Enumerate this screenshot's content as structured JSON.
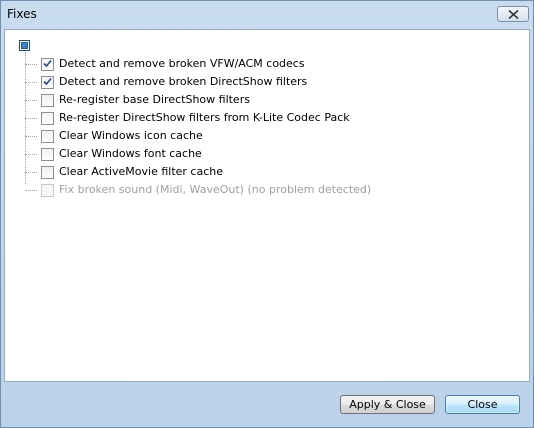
{
  "window": {
    "title": "Fixes"
  },
  "tree": {
    "items": [
      {
        "label": "Detect and remove broken VFW/ACM codecs",
        "checked": true,
        "enabled": true
      },
      {
        "label": "Detect and remove broken DirectShow filters",
        "checked": true,
        "enabled": true
      },
      {
        "label": "Re-register base DirectShow filters",
        "checked": false,
        "enabled": true
      },
      {
        "label": "Re-register DirectShow filters from K-Lite Codec Pack",
        "checked": false,
        "enabled": true
      },
      {
        "label": "Clear Windows icon cache",
        "checked": false,
        "enabled": true
      },
      {
        "label": "Clear Windows font cache",
        "checked": false,
        "enabled": true
      },
      {
        "label": "Clear ActiveMovie filter cache",
        "checked": false,
        "enabled": true
      },
      {
        "label": "Fix broken sound (Midi, WaveOut)  (no problem detected)",
        "checked": false,
        "enabled": false
      }
    ]
  },
  "buttons": {
    "apply_label": "Apply & Close",
    "close_label": "Close"
  },
  "icons": {
    "close": "close-icon",
    "check": "check-icon"
  }
}
